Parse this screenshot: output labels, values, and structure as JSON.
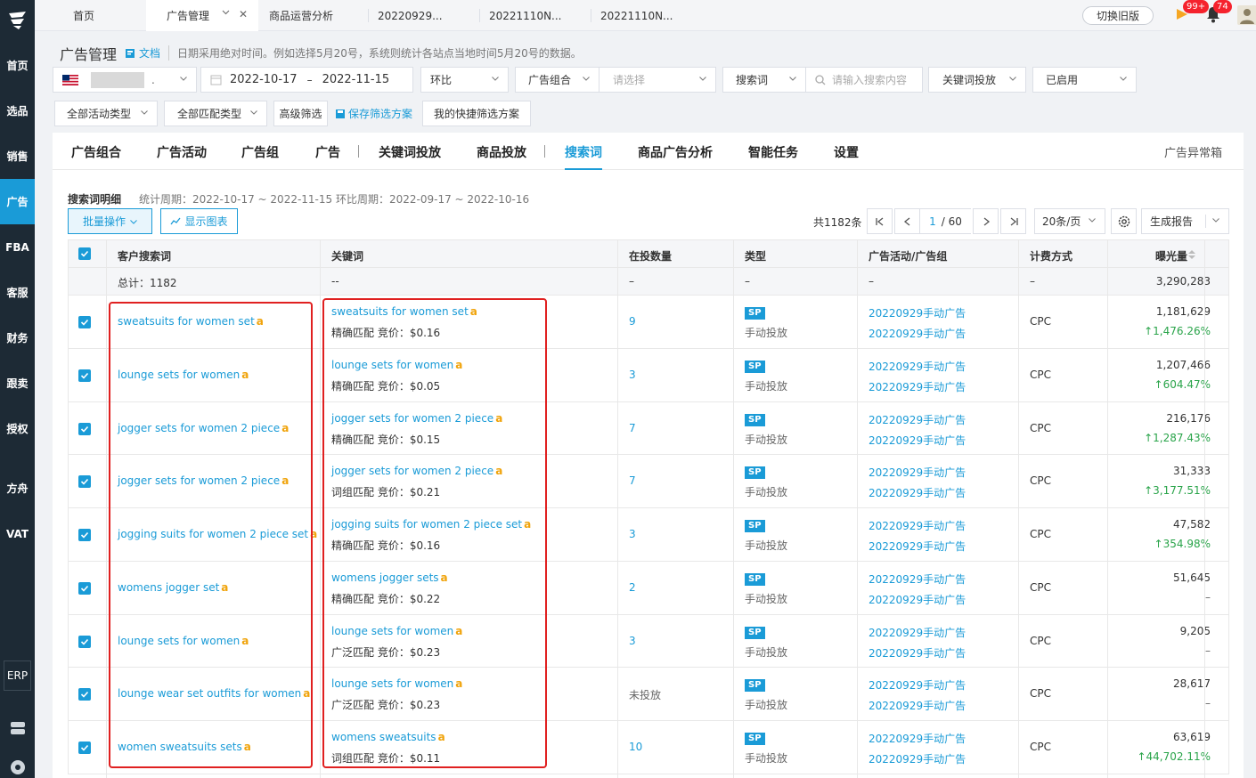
{
  "sidebar": {
    "items": [
      {
        "label": "首页"
      },
      {
        "label": "选品"
      },
      {
        "label": "销售"
      },
      {
        "label": "广告"
      },
      {
        "label": "FBA"
      },
      {
        "label": "客服"
      },
      {
        "label": "财务"
      },
      {
        "label": "跟卖"
      },
      {
        "label": "授权"
      },
      {
        "label": "方舟"
      },
      {
        "label": "VAT"
      }
    ],
    "erp_label": "ERP"
  },
  "topbar": {
    "tabs": [
      {
        "label": "首页"
      },
      {
        "label": "广告管理"
      },
      {
        "label": "商品运营分析"
      },
      {
        "label": "20220929..."
      },
      {
        "label": "20221110N..."
      },
      {
        "label": "20221110N..."
      }
    ],
    "old_version_label": "切换旧版",
    "notify_count": "99+",
    "bell_count": "74"
  },
  "header": {
    "title": "广告管理",
    "doc_label": "文档",
    "note": "日期采用绝对时间。例如选择5月20号，系统则统计各站点当地时间5月20号的数据。"
  },
  "filters": {
    "store_suffix": ".",
    "date_start": "2022-10-17",
    "date_sep": "–",
    "date_end": "2022-11-15",
    "compare": "环比",
    "ad_group_label": "广告组合",
    "ad_group_placeholder": "请选择",
    "search_type": "搜索词",
    "search_placeholder": "请输入搜索内容",
    "keyword_target": "关键词投放",
    "status": "已启用",
    "activity_type": "全部活动类型",
    "match_type": "全部匹配类型",
    "advanced": "高级筛选",
    "save_scheme": "保存筛选方案",
    "my_schemes": "我的快捷筛选方案"
  },
  "main_tabs": [
    {
      "label": "广告组合"
    },
    {
      "label": "广告活动"
    },
    {
      "label": "广告组"
    },
    {
      "label": "广告"
    },
    {
      "label": "关键词投放"
    },
    {
      "label": "商品投放"
    },
    {
      "label": "搜索词"
    },
    {
      "label": "商品广告分析"
    },
    {
      "label": "智能任务"
    },
    {
      "label": "设置"
    }
  ],
  "abnormal_box": "广告异常箱",
  "detail": {
    "title": "搜索词明细",
    "period": "统计周期：2022-10-17 ~ 2022-11-15 环比周期：2022-09-17 ~ 2022-10-16",
    "bulk_label": "批量操作",
    "chart_label": "显示图表",
    "total": "共1182条",
    "page_current": "1",
    "page_total": "/ 60",
    "page_size": "20条/页",
    "report_label": "生成报告"
  },
  "table": {
    "headers": {
      "search_term": "客户搜索词",
      "keyword": "关键词",
      "count": "在投数量",
      "type": "类型",
      "campaign": "广告活动/广告组",
      "billing": "计费方式",
      "impressions": "曝光量"
    },
    "summary": {
      "label": "总计：1182",
      "keyword": "--",
      "count": "–",
      "type": "–",
      "campaign": "–",
      "billing": "–",
      "impressions": "3,290,283"
    },
    "amazon_mark": "a",
    "rows": [
      {
        "term": "sweatsuits for women set",
        "keyword": "sweatsuits for women set",
        "match": "精确匹配 竞价：$0.16",
        "count": "9",
        "badge": "SP",
        "mode": "手动投放",
        "campaign": "20220929手动广告",
        "group": "20220929手动广告",
        "billing": "CPC",
        "impressions": "1,181,629",
        "change": "↑1,476.26%"
      },
      {
        "term": "lounge sets for women",
        "keyword": "lounge sets for women",
        "match": "精确匹配 竞价：$0.05",
        "count": "3",
        "badge": "SP",
        "mode": "手动投放",
        "campaign": "20220929手动广告",
        "group": "20220929手动广告",
        "billing": "CPC",
        "impressions": "1,207,466",
        "change": "↑604.47%"
      },
      {
        "term": "jogger sets for women 2 piece",
        "keyword": "jogger sets for women 2 piece",
        "match": "精确匹配 竞价：$0.15",
        "count": "7",
        "badge": "SP",
        "mode": "手动投放",
        "campaign": "20220929手动广告",
        "group": "20220929手动广告",
        "billing": "CPC",
        "impressions": "216,176",
        "change": "↑1,287.43%"
      },
      {
        "term": "jogger sets for women 2 piece",
        "keyword": "jogger sets for women 2 piece",
        "match": "词组匹配 竞价：$0.21",
        "count": "7",
        "badge": "SP",
        "mode": "手动投放",
        "campaign": "20220929手动广告",
        "group": "20220929手动广告",
        "billing": "CPC",
        "impressions": "31,333",
        "change": "↑3,177.51%"
      },
      {
        "term": "jogging suits for women 2 piece set",
        "keyword": "jogging suits for women 2 piece set",
        "match": "精确匹配 竞价：$0.16",
        "count": "3",
        "badge": "SP",
        "mode": "手动投放",
        "campaign": "20220929手动广告",
        "group": "20220929手动广告",
        "billing": "CPC",
        "impressions": "47,582",
        "change": "↑354.98%"
      },
      {
        "term": "womens jogger set",
        "keyword": "womens jogger sets",
        "match": "精确匹配 竞价：$0.22",
        "count": "2",
        "badge": "SP",
        "mode": "手动投放",
        "campaign": "20220929手动广告",
        "group": "20220929手动广告",
        "billing": "CPC",
        "impressions": "51,645",
        "change": "–"
      },
      {
        "term": "lounge sets for women",
        "keyword": "lounge sets for women",
        "match": "广泛匹配 竞价：$0.23",
        "count": "3",
        "badge": "SP",
        "mode": "手动投放",
        "campaign": "20220929手动广告",
        "group": "20220929手动广告",
        "billing": "CPC",
        "impressions": "9,205",
        "change": "–"
      },
      {
        "term": "lounge wear set outfits for women",
        "keyword": "lounge sets for women",
        "match": "广泛匹配 竞价：$0.23",
        "count": "未投放",
        "badge": "SP",
        "mode": "手动投放",
        "campaign": "20220929手动广告",
        "group": "20220929手动广告",
        "billing": "CPC",
        "impressions": "28,617",
        "change": "–"
      },
      {
        "term": "women sweatsuits sets",
        "keyword": "womens sweatsuits",
        "match": "词组匹配 竞价：$0.11",
        "count": "10",
        "badge": "SP",
        "mode": "手动投放",
        "campaign": "20220929手动广告",
        "group": "20220929手动广告",
        "billing": "CPC",
        "impressions": "63,619",
        "change": "↑44,702.11%"
      }
    ]
  },
  "colors": {
    "accent": "#1a9bd7",
    "sidebar": "#1d2a35",
    "up": "#2aa44a",
    "highlight": "#e02020"
  }
}
